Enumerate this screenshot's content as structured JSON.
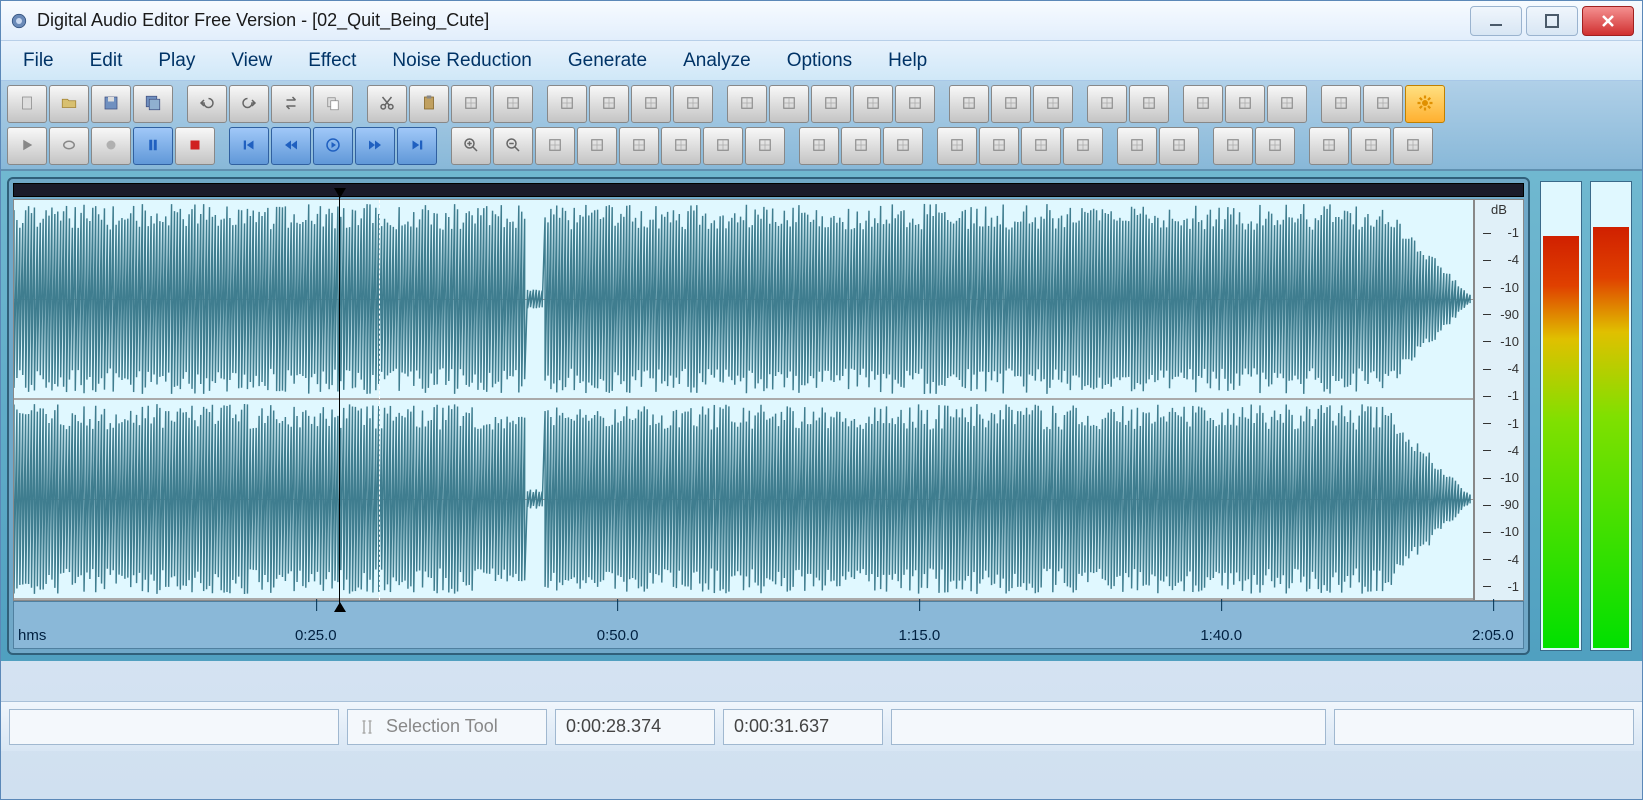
{
  "window": {
    "title": "Digital Audio Editor Free Version - [02_Quit_Being_Cute]"
  },
  "menu": {
    "items": [
      "File",
      "Edit",
      "Play",
      "View",
      "Effect",
      "Noise Reduction",
      "Generate",
      "Analyze",
      "Options",
      "Help"
    ]
  },
  "toolbar_row1": [
    {
      "name": "new",
      "icon": "file"
    },
    {
      "name": "open",
      "icon": "folder"
    },
    {
      "name": "save",
      "icon": "disk"
    },
    {
      "name": "save-as",
      "icon": "disks"
    },
    {
      "sep": true
    },
    {
      "name": "undo",
      "icon": "undo"
    },
    {
      "name": "redo",
      "icon": "redo"
    },
    {
      "name": "repeat",
      "icon": "repeat"
    },
    {
      "name": "copy",
      "icon": "copy"
    },
    {
      "sep": true
    },
    {
      "name": "cut",
      "icon": "cut"
    },
    {
      "name": "paste",
      "icon": "paste"
    },
    {
      "name": "paste-mix",
      "icon": "pastemix"
    },
    {
      "name": "paste-from",
      "icon": "pastefile"
    },
    {
      "sep": true
    },
    {
      "name": "trim",
      "icon": "trim"
    },
    {
      "name": "select-all",
      "icon": "selectall"
    },
    {
      "name": "delete",
      "icon": "delete"
    },
    {
      "name": "delete-sel",
      "icon": "delsel"
    },
    {
      "sep": true
    },
    {
      "name": "mute-left",
      "icon": "mutel"
    },
    {
      "name": "mute-right",
      "icon": "muter"
    },
    {
      "name": "swap",
      "icon": "swap"
    },
    {
      "name": "invert",
      "icon": "invert"
    },
    {
      "name": "insert-silence",
      "icon": "silence"
    },
    {
      "sep": true
    },
    {
      "name": "brightness",
      "icon": "sun"
    },
    {
      "name": "reduce",
      "icon": "reduce"
    },
    {
      "name": "filter",
      "icon": "filter"
    },
    {
      "sep": true
    },
    {
      "name": "tag",
      "icon": "tag"
    },
    {
      "name": "cd",
      "icon": "cd"
    },
    {
      "sep": true
    },
    {
      "name": "mixer",
      "icon": "mixer"
    },
    {
      "name": "speaker",
      "icon": "speaker"
    },
    {
      "name": "mic",
      "icon": "mic"
    },
    {
      "sep": true
    },
    {
      "name": "fullscreen",
      "icon": "expand"
    },
    {
      "name": "tuning",
      "icon": "tuning"
    },
    {
      "name": "settings",
      "icon": "gear",
      "highlight": true
    }
  ],
  "toolbar_row2": [
    {
      "name": "play",
      "icon": "play"
    },
    {
      "name": "loop",
      "icon": "loop"
    },
    {
      "name": "record",
      "icon": "circle"
    },
    {
      "name": "pause",
      "icon": "pause",
      "active": true
    },
    {
      "name": "stop",
      "icon": "stop-red"
    },
    {
      "sep": true
    },
    {
      "name": "go-start",
      "icon": "skip-start",
      "active": true
    },
    {
      "name": "rewind",
      "icon": "rewind",
      "active": true
    },
    {
      "name": "play-cursor",
      "icon": "play-circle",
      "active": true
    },
    {
      "name": "forward",
      "icon": "fastfwd",
      "active": true
    },
    {
      "name": "go-end",
      "icon": "skip-end",
      "active": true
    },
    {
      "sep": true
    },
    {
      "name": "zoom-in",
      "icon": "zoomin"
    },
    {
      "name": "zoom-out",
      "icon": "zoomout"
    },
    {
      "name": "zoom-sel",
      "icon": "zoomsel"
    },
    {
      "name": "zoom-full",
      "icon": "zoomfull"
    },
    {
      "name": "zoom-left",
      "icon": "zooml"
    },
    {
      "name": "zoom-right",
      "icon": "zoomr"
    },
    {
      "name": "zoom-in-v",
      "icon": "zoominv"
    },
    {
      "name": "zoom-out-v",
      "icon": "zoomoutv"
    },
    {
      "sep": true
    },
    {
      "name": "fit",
      "icon": "fit"
    },
    {
      "name": "back",
      "icon": "back"
    },
    {
      "name": "equal",
      "icon": "equal"
    },
    {
      "sep": true
    },
    {
      "name": "amp-up",
      "icon": "ampup"
    },
    {
      "name": "amp-down",
      "icon": "ampdown"
    },
    {
      "name": "amp-fit",
      "icon": "ampfit"
    },
    {
      "name": "volume",
      "icon": "vol"
    },
    {
      "sep": true
    },
    {
      "name": "wave1",
      "icon": "w1"
    },
    {
      "name": "wave2",
      "icon": "w2"
    },
    {
      "sep": true
    },
    {
      "name": "env1",
      "icon": "e1"
    },
    {
      "name": "env2",
      "icon": "e2"
    },
    {
      "sep": true
    },
    {
      "name": "fx1",
      "icon": "fx1"
    },
    {
      "name": "fx2",
      "icon": "fx2"
    },
    {
      "name": "eq",
      "icon": "eq"
    }
  ],
  "db_scale": {
    "header": "dB",
    "values": [
      "-1",
      "-4",
      "-10",
      "-90",
      "-10",
      "-4",
      "-1"
    ]
  },
  "time_ruler": {
    "unit": "hms",
    "ticks": [
      {
        "pos": 20,
        "label": "0:25.0"
      },
      {
        "pos": 40,
        "label": "0:50.0"
      },
      {
        "pos": 60,
        "label": "1:15.0"
      },
      {
        "pos": 80,
        "label": "1:40.0"
      },
      {
        "pos": 98,
        "label": "2:05.0"
      }
    ]
  },
  "cursor": {
    "position_pct": 22.3,
    "selection_end_pct": 25.0
  },
  "meters": {
    "left_pct": 88,
    "right_pct": 90
  },
  "status": {
    "tool_label": "Selection Tool",
    "time_start": "0:00:28.374",
    "time_end": "0:00:31.637"
  },
  "colors": {
    "waveform": "#3f7d8f",
    "wave_bg": "#e0f8ff"
  }
}
